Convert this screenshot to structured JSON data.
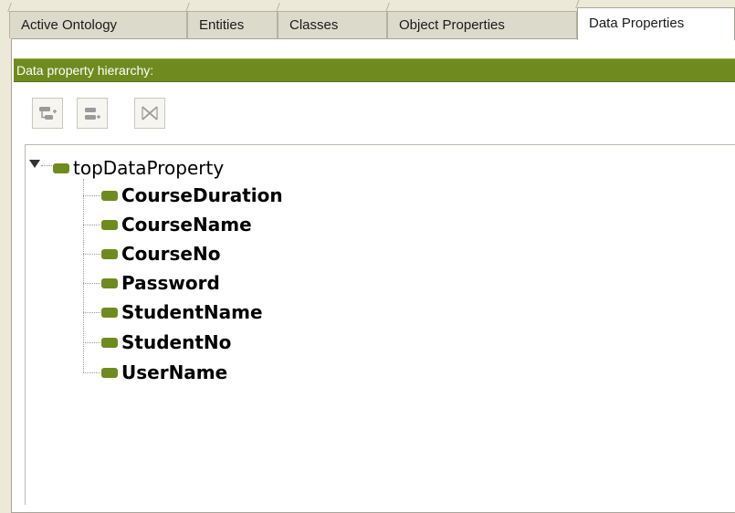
{
  "tabs": [
    {
      "label": "Active Ontology",
      "active": false
    },
    {
      "label": "Entities",
      "active": false
    },
    {
      "label": "Classes",
      "active": false
    },
    {
      "label": "Object Properties",
      "active": false
    },
    {
      "label": "Data Properties",
      "active": true
    }
  ],
  "panel": {
    "title": "Data property hierarchy:",
    "toolbar": [
      {
        "icon": "add-subproperty-icon"
      },
      {
        "icon": "add-sibling-property-icon"
      },
      {
        "icon": "delete-property-icon"
      }
    ]
  },
  "tree": {
    "root": {
      "label": "topDataProperty",
      "expanded": true,
      "icon": "data-property-icon"
    },
    "children": [
      {
        "label": "CourseDuration"
      },
      {
        "label": "CourseName"
      },
      {
        "label": "CourseNo"
      },
      {
        "label": "Password"
      },
      {
        "label": "StudentName"
      },
      {
        "label": "StudentNo"
      },
      {
        "label": "UserName"
      }
    ]
  },
  "colors": {
    "accent": "#6f8b1f",
    "background": "#ece9d8"
  }
}
